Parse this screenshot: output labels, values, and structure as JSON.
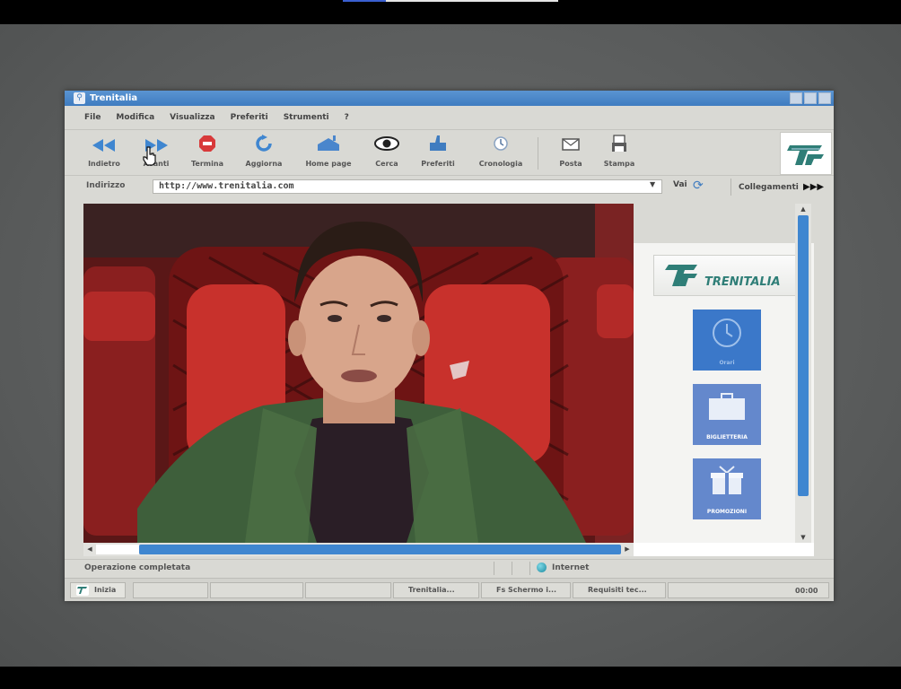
{
  "window": {
    "title": "Trenitalia"
  },
  "menu": [
    "File",
    "Modifica",
    "Visualizza",
    "Preferiti",
    "Strumenti",
    "?"
  ],
  "toolbar": {
    "back": "Indietro",
    "forward": "Avanti",
    "stop": "Termina",
    "refresh": "Aggiorna",
    "home": "Home page",
    "search": "Cerca",
    "favorites": "Preferiti",
    "history": "Cronologia",
    "mail": "Posta",
    "print": "Stampa"
  },
  "address": {
    "label": "Indirizzo",
    "value": "http://www.trenitalia.com",
    "go_label": "Vai",
    "links_label": "Collegamenti"
  },
  "sidebar": {
    "logo_text": "TRENITALIA",
    "tiles": [
      {
        "label": "Orari",
        "color": "#3b78c9"
      },
      {
        "label": "BIGLIETTERIA",
        "color": "#6488cc"
      },
      {
        "label": "PROMOZIONI",
        "color": "#6488cc"
      }
    ]
  },
  "status": {
    "text": "Operazione completata",
    "zone": "Internet"
  },
  "taskbar": {
    "start": "Inizia",
    "items": [
      "Trenitalia...",
      "Fs Schermo i...",
      "Requisiti tec..."
    ],
    "clock": "00:00"
  },
  "colors": {
    "titlebar": "#3f7cc0",
    "scroll_thumb": "#3f86d0",
    "brand_green": "#2f7e77"
  },
  "icons": {
    "back": "double-left-arrow-icon",
    "forward": "double-right-arrow-icon",
    "stop": "stop-icon",
    "refresh": "refresh-icon",
    "home": "home-icon",
    "search": "eye-icon",
    "favorites": "favorites-hand-icon",
    "history": "clock-icon",
    "mail": "mail-icon",
    "print": "printer-icon"
  }
}
